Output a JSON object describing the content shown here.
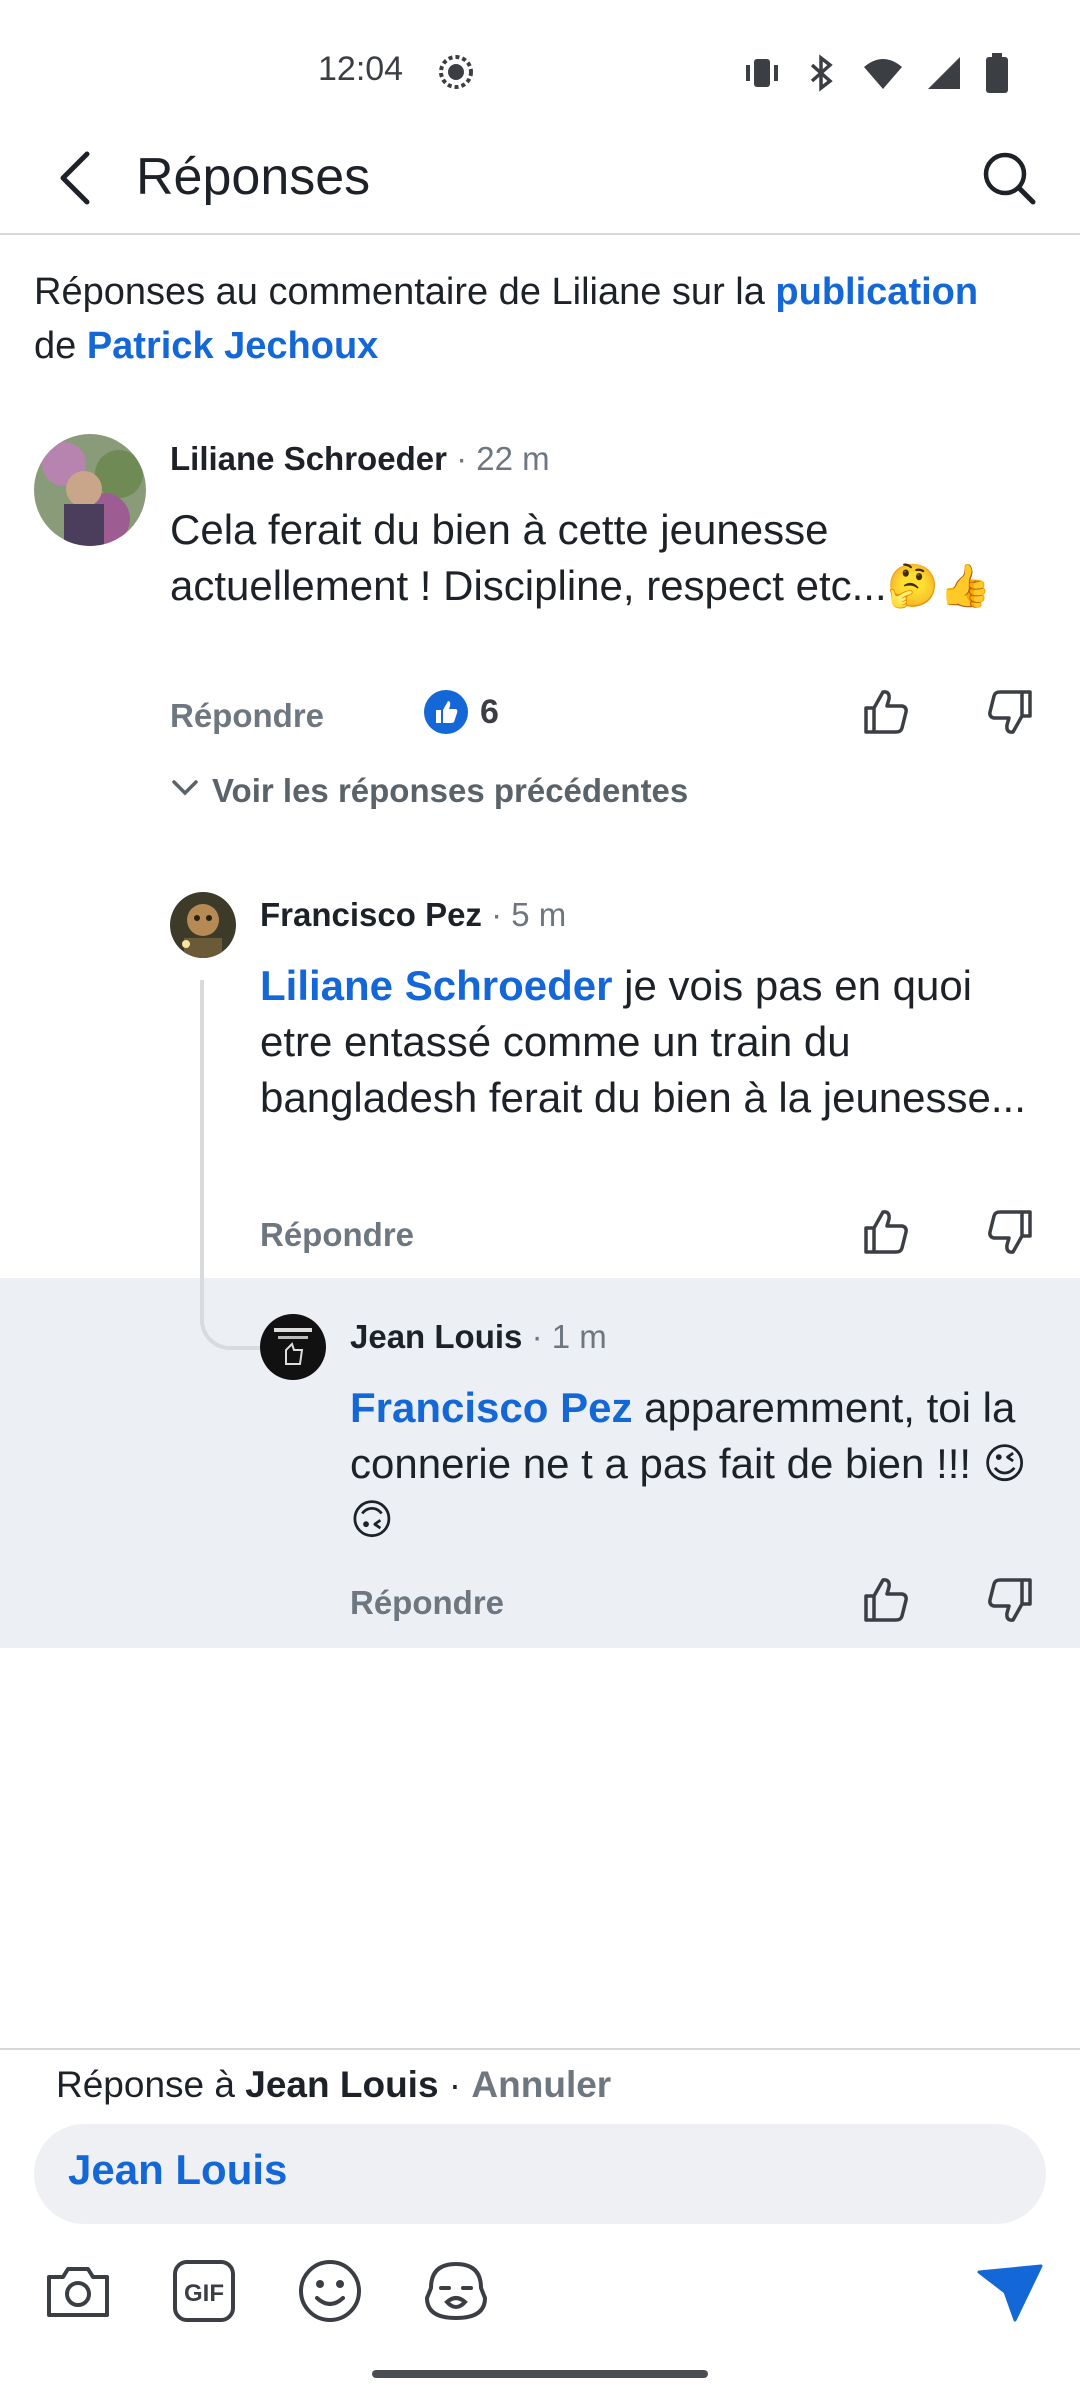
{
  "status_bar": {
    "time": "12:04",
    "icons": [
      "chat-bubble-icon",
      "vibrate-icon",
      "bluetooth-icon",
      "wifi-icon",
      "signal-icon",
      "battery-icon"
    ]
  },
  "header": {
    "title": "Réponses",
    "back_icon": "back-arrow-icon",
    "search_icon": "search-icon"
  },
  "context": {
    "prefix": "Réponses au commentaire de Liliane sur la ",
    "post_link": "publication",
    "middle": " de ",
    "author_link": "Patrick Jechoux"
  },
  "comments": [
    {
      "author": "Liliane Schroeder",
      "time": "· 22 m",
      "text": "Cela ferait du bien à cette jeunesse actuellement ! Discipline, respect etc...🤔👍",
      "reply_label": "Répondre",
      "reaction_count": "6"
    },
    {
      "author": "Francisco Pez",
      "time": "· 5 m",
      "mention": "Liliane Schroeder",
      "text": " je vois pas en quoi etre entassé comme un train du bangladesh ferait du bien à la jeunesse...",
      "reply_label": "Répondre"
    },
    {
      "author": "Jean Louis",
      "time": "· 1 m",
      "mention": "Francisco Pez",
      "text": " apparemment,  toi la connerie ne t a pas fait de bien !!! 😉🙃",
      "reply_label": "Répondre"
    }
  ],
  "view_previous": "Voir les réponses précédentes",
  "composer": {
    "reply_prefix": "Réponse à ",
    "reply_target": "Jean Louis",
    "separator": " · ",
    "cancel": "Annuler",
    "input_mention": "Jean Louis",
    "tools": [
      "camera-icon",
      "gif-icon",
      "emoji-icon",
      "sticker-icon"
    ],
    "send_icon": "send-icon"
  },
  "colors": {
    "accent": "#1467d6",
    "muted": "#6e7780",
    "highlight": "#eceff4"
  }
}
